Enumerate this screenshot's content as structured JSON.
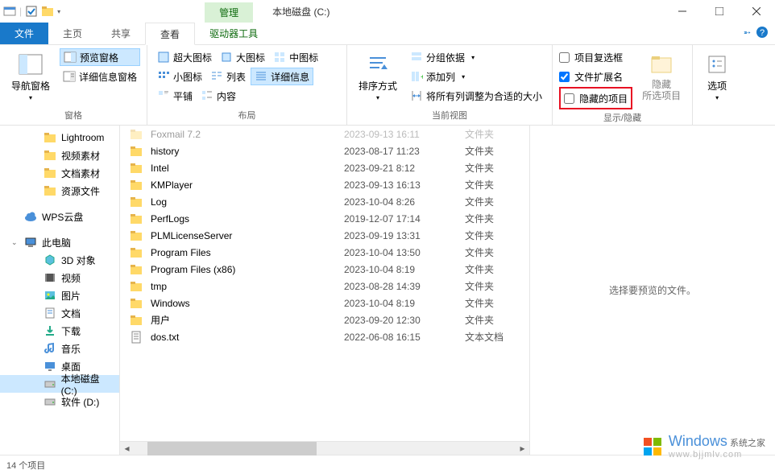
{
  "window": {
    "title": "本地磁盘 (C:)",
    "management_tab": "管理"
  },
  "tabs": {
    "file": "文件",
    "home": "主页",
    "share": "共享",
    "view": "查看",
    "drive_tools": "驱动器工具"
  },
  "ribbon": {
    "panes": {
      "nav_pane": "导航窗格",
      "preview_pane": "预览窗格",
      "details_pane": "详细信息窗格",
      "group_label": "窗格"
    },
    "layout": {
      "extra_large": "超大图标",
      "large_icons": "大图标",
      "medium_icons": "中图标",
      "small_icons": "小图标",
      "list": "列表",
      "details": "详细信息",
      "tiles": "平铺",
      "content": "内容",
      "group_label": "布局"
    },
    "current_view": {
      "sort_by": "排序方式",
      "group_by": "分组依据",
      "add_columns": "添加列",
      "size_columns": "将所有列调整为合适的大小",
      "group_label": "当前视图"
    },
    "show_hide": {
      "item_checkboxes": "项目复选框",
      "file_ext": "文件扩展名",
      "hidden_items": "隐藏的项目",
      "hide_selected": "隐藏所选项目",
      "group_label": "显示/隐藏"
    },
    "options": {
      "label": "选项"
    }
  },
  "nav_items": [
    {
      "label": "Lightroom",
      "type": "folder"
    },
    {
      "label": "视频素材",
      "type": "folder"
    },
    {
      "label": "文档素材",
      "type": "folder"
    },
    {
      "label": "资源文件",
      "type": "folder"
    },
    {
      "label": "WPS云盘",
      "type": "cloud"
    },
    {
      "label": "此电脑",
      "type": "pc"
    },
    {
      "label": "3D 对象",
      "type": "3d"
    },
    {
      "label": "视频",
      "type": "video"
    },
    {
      "label": "图片",
      "type": "pictures"
    },
    {
      "label": "文档",
      "type": "docs"
    },
    {
      "label": "下载",
      "type": "downloads"
    },
    {
      "label": "音乐",
      "type": "music"
    },
    {
      "label": "桌面",
      "type": "desktop"
    },
    {
      "label": "本地磁盘 (C:)",
      "type": "drive",
      "selected": true
    },
    {
      "label": "软件 (D:)",
      "type": "drive"
    }
  ],
  "files": [
    {
      "name": "Foxmail 7.2",
      "date": "2023-09-13 16:11",
      "type": "文件夹",
      "icon": "folder"
    },
    {
      "name": "history",
      "date": "2023-08-17 11:23",
      "type": "文件夹",
      "icon": "folder"
    },
    {
      "name": "Intel",
      "date": "2023-09-21 8:12",
      "type": "文件夹",
      "icon": "folder"
    },
    {
      "name": "KMPlayer",
      "date": "2023-09-13 16:13",
      "type": "文件夹",
      "icon": "folder"
    },
    {
      "name": "Log",
      "date": "2023-10-04 8:26",
      "type": "文件夹",
      "icon": "folder"
    },
    {
      "name": "PerfLogs",
      "date": "2019-12-07 17:14",
      "type": "文件夹",
      "icon": "folder"
    },
    {
      "name": "PLMLicenseServer",
      "date": "2023-09-19 13:31",
      "type": "文件夹",
      "icon": "folder"
    },
    {
      "name": "Program Files",
      "date": "2023-10-04 13:50",
      "type": "文件夹",
      "icon": "folder"
    },
    {
      "name": "Program Files (x86)",
      "date": "2023-10-04 8:19",
      "type": "文件夹",
      "icon": "folder"
    },
    {
      "name": "tmp",
      "date": "2023-08-28 14:39",
      "type": "文件夹",
      "icon": "folder"
    },
    {
      "name": "Windows",
      "date": "2023-10-04 8:19",
      "type": "文件夹",
      "icon": "folder"
    },
    {
      "name": "用户",
      "date": "2023-09-20 12:30",
      "type": "文件夹",
      "icon": "folder"
    },
    {
      "name": "dos.txt",
      "date": "2022-06-08 16:15",
      "type": "文本文档",
      "icon": "text"
    }
  ],
  "preview": {
    "empty_text": "选择要预览的文件。"
  },
  "status": {
    "item_count": "14 个项目"
  },
  "watermark": {
    "brand": "Windows",
    "site": "系统之家",
    "url": "www.bjjmlv.com"
  }
}
